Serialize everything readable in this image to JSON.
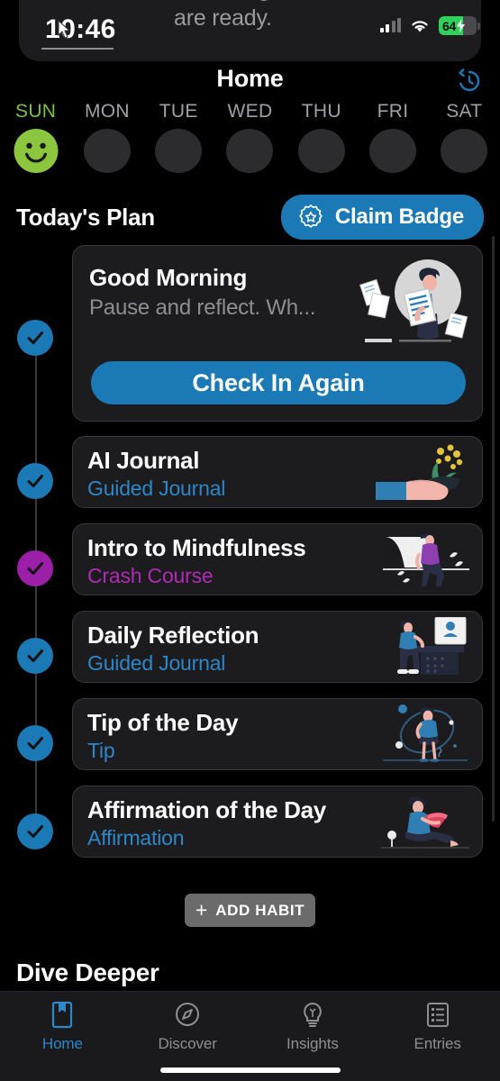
{
  "status_bar": {
    "time": "10:46",
    "battery_level": "64",
    "battery_charging": true,
    "wifi_icon": "wifi-icon",
    "signal_icon": "cellular-signal-icon",
    "battery_icon": "battery-icon"
  },
  "notification": {
    "text": "Your insights from last month are ready.",
    "thumbnail_icon": "notification-thumbnail"
  },
  "header": {
    "title": "Home",
    "history_icon": "history-clock-icon"
  },
  "week": {
    "days": [
      {
        "label": "SUN",
        "active": true,
        "mood_icon": "smiley-face-icon"
      },
      {
        "label": "MON",
        "active": false,
        "mood_icon": "empty-circle-icon"
      },
      {
        "label": "TUE",
        "active": false,
        "mood_icon": "empty-circle-icon"
      },
      {
        "label": "WED",
        "active": false,
        "mood_icon": "empty-circle-icon"
      },
      {
        "label": "THU",
        "active": false,
        "mood_icon": "empty-circle-icon"
      },
      {
        "label": "FRI",
        "active": false,
        "mood_icon": "empty-circle-icon"
      },
      {
        "label": "SAT",
        "active": false,
        "mood_icon": "empty-circle-icon"
      }
    ]
  },
  "section": {
    "title": "Today's Plan",
    "claim_badge_label": "Claim Badge",
    "claim_badge_icon": "badge-rosette-icon",
    "accent_blue": "#1b7ab5",
    "accent_purple": "#9c1fa8",
    "accent_green": "#8cc63f"
  },
  "check_in_card": {
    "title": "Good Morning",
    "subtitle": "Pause and reflect. Wh...",
    "button_label": "Check In Again",
    "illustration_icon": "woman-with-documents-illustration",
    "status_icon": "check-circle-icon",
    "status_color": "#1b7ab5"
  },
  "habits": [
    {
      "title": "AI Journal",
      "type": "Guided Journal",
      "type_color": "blue",
      "status_color": "#1b7ab5",
      "status_icon": "check-circle-icon",
      "illustration_icon": "hand-holding-plant-illustration"
    },
    {
      "title": "Intro to Mindfulness",
      "type": "Crash Course",
      "type_color": "purple",
      "status_color": "#9c1fa8",
      "status_icon": "check-circle-icon",
      "illustration_icon": "person-walking-illustration"
    },
    {
      "title": "Daily Reflection",
      "type": "Guided Journal",
      "type_color": "blue",
      "status_color": "#1b7ab5",
      "status_icon": "check-circle-icon",
      "illustration_icon": "person-at-desk-illustration"
    },
    {
      "title": "Tip of the Day",
      "type": "Tip",
      "type_color": "blue",
      "status_color": "#1b7ab5",
      "status_icon": "check-circle-icon",
      "illustration_icon": "woman-thinking-illustration"
    },
    {
      "title": "Affirmation of the Day",
      "type": "Affirmation",
      "type_color": "blue",
      "status_color": "#1b7ab5",
      "status_icon": "check-circle-icon",
      "illustration_icon": "person-reading-illustration"
    }
  ],
  "add_habit": {
    "label": "ADD HABIT",
    "plus_icon": "plus-icon"
  },
  "next_section": {
    "title": "Dive Deeper"
  },
  "tab_bar": {
    "tabs": [
      {
        "label": "Home",
        "icon": "book-bookmark-icon",
        "active": true
      },
      {
        "label": "Discover",
        "icon": "compass-icon",
        "active": false
      },
      {
        "label": "Insights",
        "icon": "lightbulb-icon",
        "active": false
      },
      {
        "label": "Entries",
        "icon": "list-document-icon",
        "active": false
      }
    ]
  }
}
